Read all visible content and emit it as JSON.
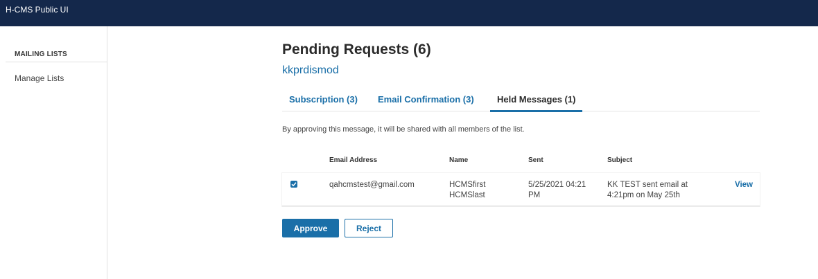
{
  "app": {
    "title": "H-CMS Public UI"
  },
  "sidebar": {
    "section_title": "MAILING LISTS",
    "items": [
      {
        "label": "Manage Lists"
      }
    ]
  },
  "main": {
    "title": "Pending Requests (6)",
    "list_name": "kkprdismod",
    "tabs": [
      {
        "label": "Subscription (3)",
        "active": false
      },
      {
        "label": "Email Confirmation (3)",
        "active": false
      },
      {
        "label": "Held Messages (1)",
        "active": true
      }
    ],
    "info_text": "By approving this message, it will be shared with all members of the list.",
    "table": {
      "headers": [
        "Email Address",
        "Name",
        "Sent",
        "Subject"
      ],
      "rows": [
        {
          "checked": true,
          "email": "qahcmstest@gmail.com",
          "name_first": "HCMSfirst",
          "name_last": "HCMSlast",
          "sent_line1": "5/25/2021 04:21",
          "sent_line2": "PM",
          "subject_line1": "KK TEST sent email at",
          "subject_line2": "4:21pm on May 25th",
          "action": "View"
        }
      ]
    },
    "buttons": {
      "approve": "Approve",
      "reject": "Reject"
    }
  },
  "colors": {
    "header_bg": "#14284b",
    "accent": "#1a6fa8"
  }
}
